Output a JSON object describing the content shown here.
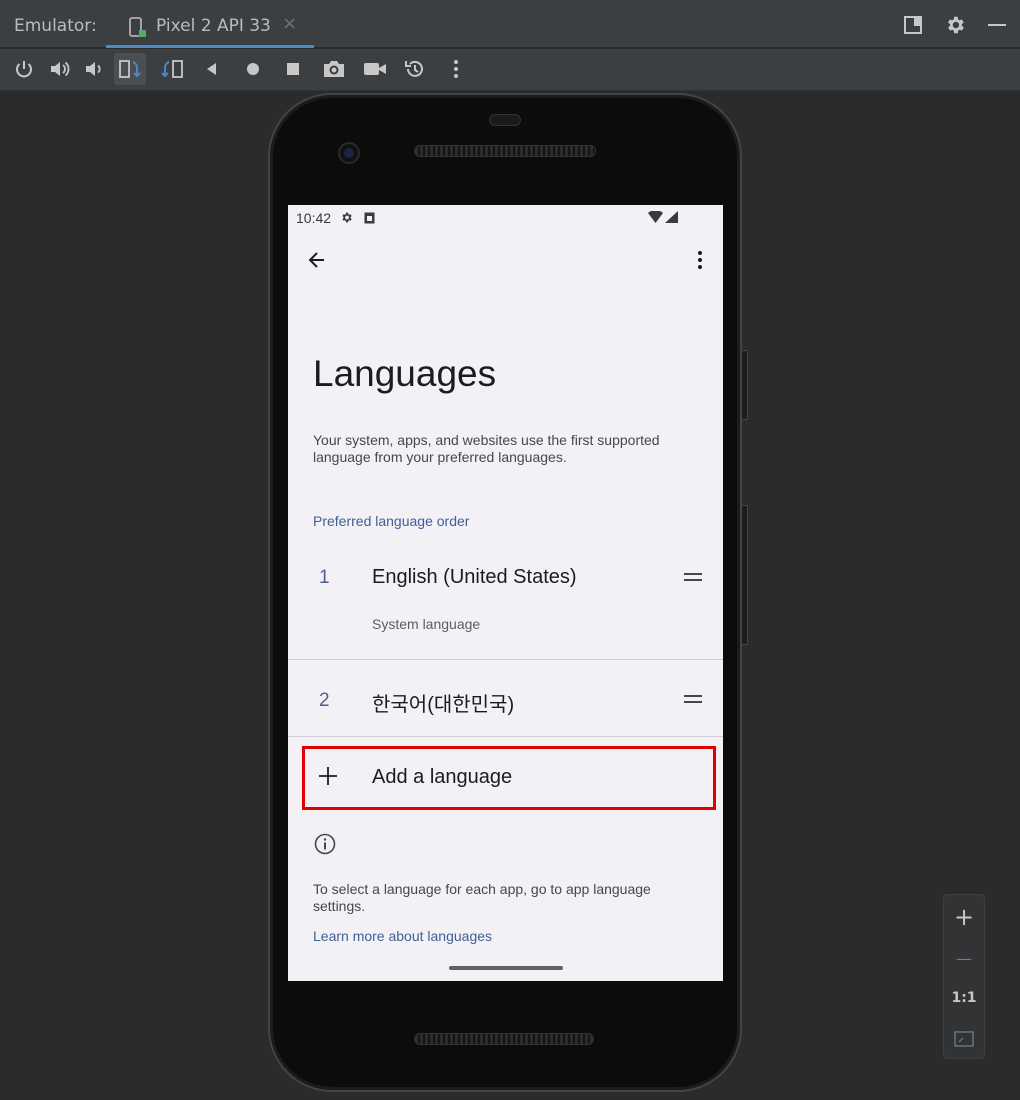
{
  "emulator": {
    "label": "Emulator:",
    "device_tab": "Pixel 2 API 33",
    "tab_close": "×"
  },
  "title_actions": [
    "window-mode-icon",
    "settings-gear-icon",
    "minimize-icon"
  ],
  "toolbar_icons": [
    "power-icon",
    "volume-up-icon",
    "volume-down-icon",
    "rotate-left-icon",
    "rotate-right-icon",
    "back-icon",
    "home-icon",
    "overview-icon",
    "screenshot-camera-icon",
    "screen-record-icon",
    "snapshot-icon",
    "more-vert-icon"
  ],
  "statusbar": {
    "time": "10:42"
  },
  "settings": {
    "title": "Languages",
    "description": "Your system, apps, and websites use the first supported language from your preferred languages.",
    "section_title": "Preferred language order",
    "languages": [
      {
        "number": "1",
        "name": "English (United States)",
        "subtitle": "System language"
      },
      {
        "number": "2",
        "name": "한국어(대한민국)"
      }
    ],
    "add_language": "Add a language",
    "footer_text": "To select a language for each app, go to app language settings.",
    "footer_link": "Learn more about languages"
  },
  "zoom": {
    "zoom_in": "+",
    "zoom_out": "—",
    "actual_size": "1:1"
  },
  "colors": {
    "accent": "#4a88c7",
    "link": "#3f5f98",
    "highlight_box": "#e10000",
    "screen_bg": "#f3f1f6"
  }
}
